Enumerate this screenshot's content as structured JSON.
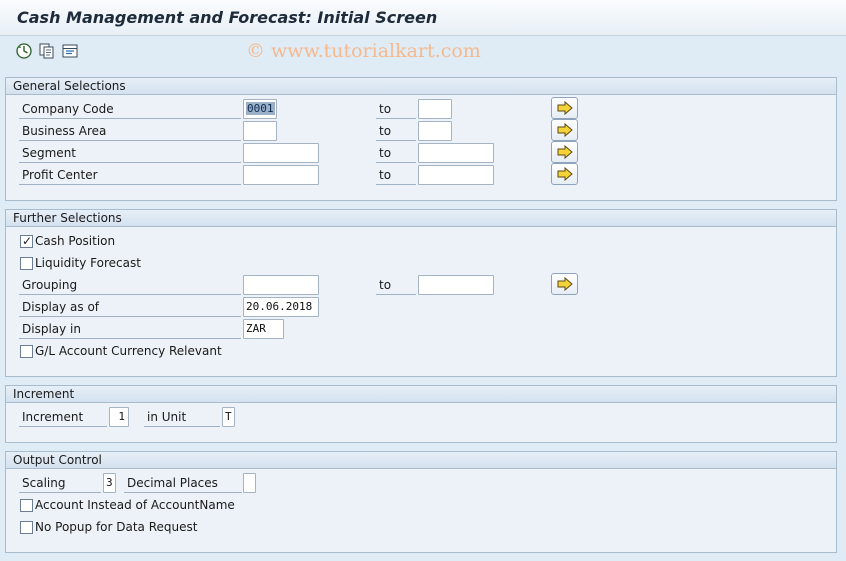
{
  "window": {
    "title": "Cash Management and Forecast: Initial Screen"
  },
  "toolbar": {
    "icons": [
      "execute-icon",
      "get-variant-icon",
      "selection-options-icon"
    ],
    "watermark": "© www.tutorialkart.com"
  },
  "general": {
    "header": "General Selections",
    "to_label": "to",
    "rows": [
      {
        "label": "Company Code",
        "from_value": "0001",
        "to_value": ""
      },
      {
        "label": "Business Area",
        "from_value": "",
        "to_value": ""
      },
      {
        "label": "Segment",
        "from_value": "",
        "to_value": ""
      },
      {
        "label": "Profit Center",
        "from_value": "",
        "to_value": ""
      }
    ]
  },
  "further": {
    "header": "Further Selections",
    "cash_position": {
      "label": "Cash Position",
      "checked": true
    },
    "liquidity_forecast": {
      "label": "Liquidity Forecast",
      "checked": false
    },
    "grouping": {
      "label": "Grouping",
      "from_value": "",
      "to_label": "to",
      "to_value": ""
    },
    "display_as_of": {
      "label": "Display as of",
      "value": "20.06.2018"
    },
    "display_in": {
      "label": "Display in",
      "value": "ZAR"
    },
    "gl_currency": {
      "label": "G/L Account Currency Relevant",
      "checked": false
    }
  },
  "increment": {
    "header": "Increment",
    "increment_label": "Increment",
    "increment_value": "1",
    "unit_label": "in Unit",
    "unit_value": "T"
  },
  "output": {
    "header": "Output Control",
    "scaling_label": "Scaling",
    "scaling_value": "3",
    "decimal_label": "Decimal Places",
    "decimal_value": "",
    "account_instead": {
      "label": "Account Instead of AccountName",
      "checked": false
    },
    "no_popup": {
      "label": "No Popup for Data Request",
      "checked": false
    }
  },
  "colors": {
    "background": "#dfebf5",
    "multiple_selection_arrow": "#f5d23a"
  }
}
